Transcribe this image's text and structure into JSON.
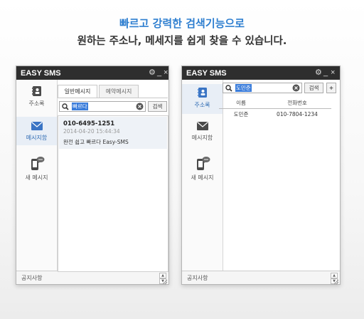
{
  "headline": {
    "line1": "빠르고 강력한 검색기능으로",
    "line2": "원하는 주소나, 메세지를 쉽게 찾을 수 있습니다."
  },
  "app_title": "EASY SMS",
  "window_controls": {
    "settings": "⚙",
    "minimize": "_",
    "close": "×"
  },
  "sidebar": {
    "items": [
      {
        "label": "주소록",
        "icon": "address-book-icon"
      },
      {
        "label": "메시지함",
        "icon": "envelope-icon"
      },
      {
        "label": "새 메시지",
        "icon": "new-message-phone-icon"
      }
    ]
  },
  "left_window": {
    "active_nav": "메시지함",
    "tabs": [
      "일반메시지",
      "예약메시지"
    ],
    "search": {
      "query": "빠르다",
      "button": "검색"
    },
    "message": {
      "number": "010-6495-1251",
      "date": "2014-04-20 15:44:34",
      "body": "완전 쉽고 빠르다 Easy-SMS"
    },
    "footer": "공지사항"
  },
  "right_window": {
    "active_nav": "주소록",
    "search": {
      "query": "도민준",
      "button": "검색",
      "add_button": "+"
    },
    "table": {
      "headers": [
        "이름",
        "전화번호"
      ],
      "rows": [
        [
          "도민준",
          "010-7804-1234"
        ]
      ]
    },
    "footer": "공지사항"
  },
  "colors": {
    "accent": "#2f7fd0",
    "titlebar": "#2e2e2e",
    "selection": "#3b7ddb"
  }
}
